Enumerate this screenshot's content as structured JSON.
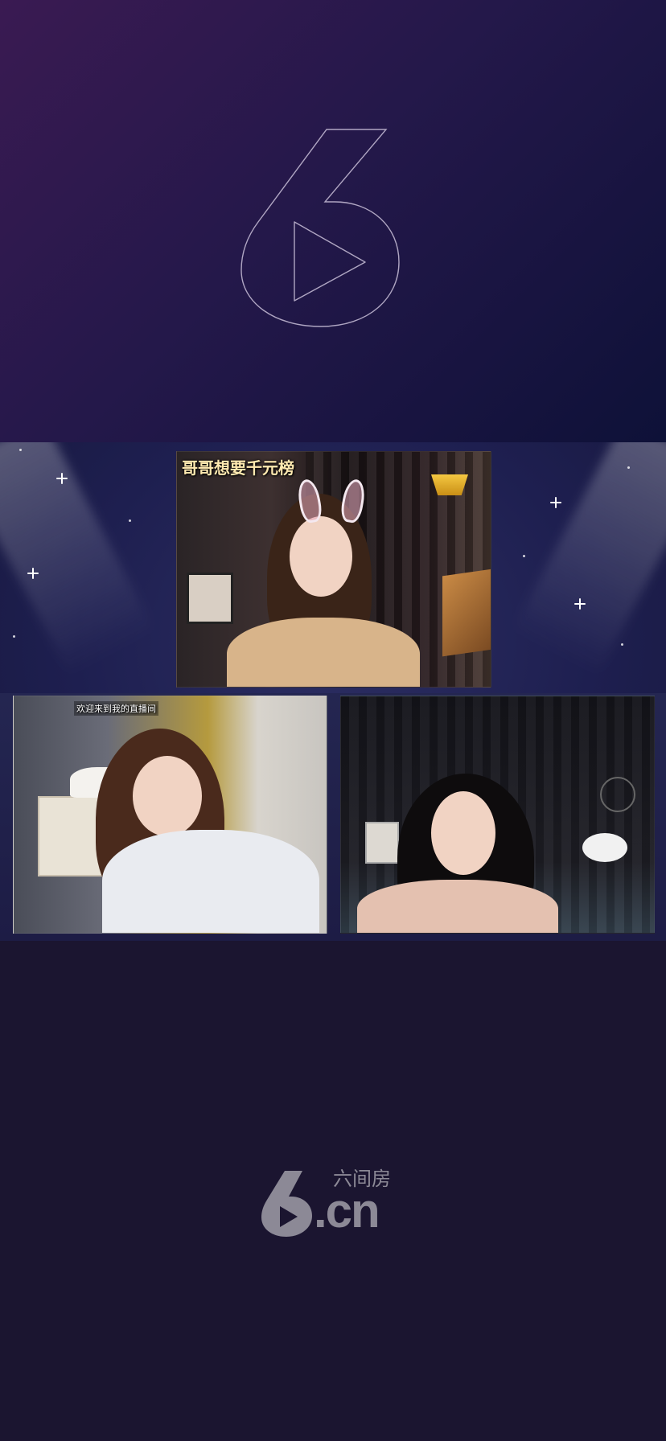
{
  "app": {
    "brand_cn": "六间房",
    "brand_domain": ".cn"
  },
  "stage": {
    "tiles": [
      {
        "id": "main",
        "caption": "哥哥想要千元榜"
      },
      {
        "id": "left",
        "caption": "欢迎来到我的直播间"
      },
      {
        "id": "right",
        "caption": ""
      }
    ]
  },
  "colors": {
    "hero_start": "#3a1a52",
    "hero_end": "#0e1138",
    "background": "#1b1530",
    "logo_gray": "#8c8996"
  },
  "icons": {
    "hero_logo": "six-play-logo-icon",
    "footer_logo": "six-cn-logo-icon",
    "badge": "rank-badge-icon"
  }
}
